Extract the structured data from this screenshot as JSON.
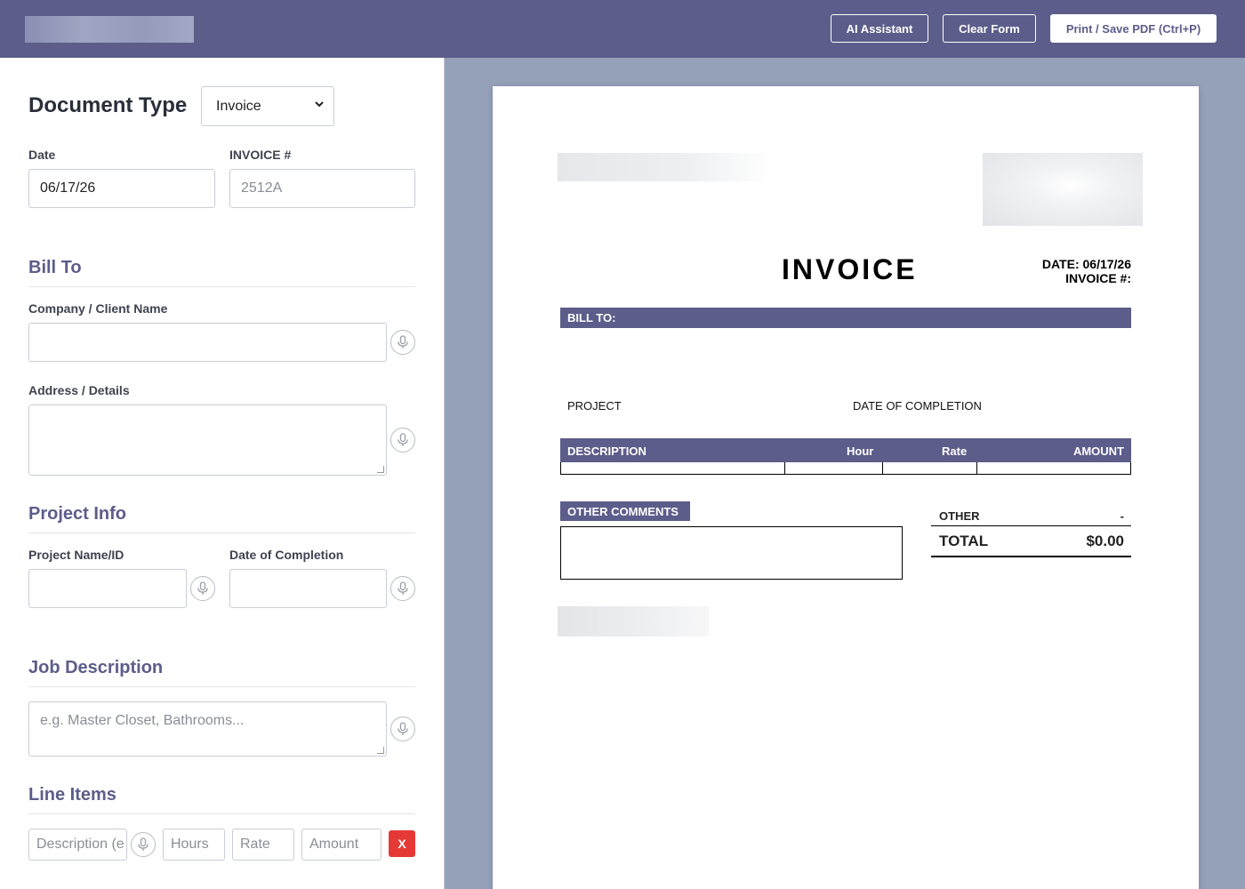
{
  "header": {
    "ai_assistant_label": "AI Assistant",
    "clear_form_label": "Clear Form",
    "print_label": "Print / Save PDF (Ctrl+P)"
  },
  "form": {
    "document_type_label": "Document Type",
    "document_type_value": "Invoice",
    "date_label": "Date",
    "date_value": "06/17/26",
    "invoice_no_label": "INVOICE #",
    "invoice_no_placeholder": "2512A",
    "bill_to_title": "Bill To",
    "company_label": "Company / Client Name",
    "company_value": "",
    "address_label": "Address / Details",
    "address_value": "",
    "project_info_title": "Project Info",
    "project_name_label": "Project Name/ID",
    "project_name_value": "",
    "date_completion_label": "Date of Completion",
    "date_completion_value": "",
    "job_description_title": "Job Description",
    "job_description_placeholder": "e.g. Master Closet, Bathrooms...",
    "line_items_title": "Line Items",
    "line_item": {
      "description_placeholder": "Description (e",
      "hours_placeholder": "Hours",
      "rate_placeholder": "Rate",
      "amount_placeholder": "Amount",
      "delete_label": "X"
    }
  },
  "preview": {
    "title": "INVOICE",
    "date_line": "DATE: 06/17/26",
    "invoice_line": "INVOICE #:",
    "bill_to_label": "BILL TO:",
    "project_label": "PROJECT",
    "date_of_completion_label": "DATE OF COMPLETION",
    "table_headers": {
      "description": "DESCRIPTION",
      "hour": "Hour",
      "rate": "Rate",
      "amount": "AMOUNT"
    },
    "other_comments_label": "OTHER COMMENTS",
    "other_label": "OTHER",
    "other_value": "-",
    "total_label": "TOTAL",
    "total_value": "$0.00"
  },
  "colors": {
    "accent": "#5c5d8a",
    "preview_background": "#94a1b9",
    "delete_red": "#e53935"
  },
  "icons": [
    "microphone-icon",
    "chevron-down-icon"
  ]
}
